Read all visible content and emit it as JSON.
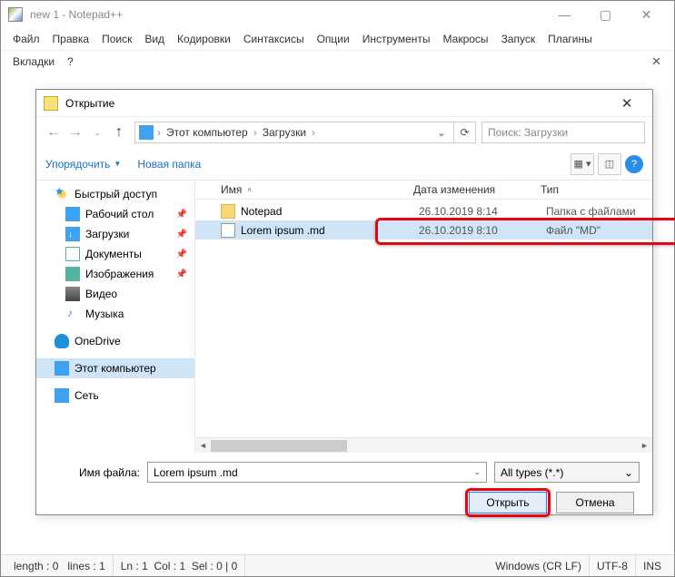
{
  "app": {
    "title": "new 1 - Notepad++"
  },
  "menus": {
    "file": "Файл",
    "edit": "Правка",
    "search": "Поиск",
    "view": "Вид",
    "encoding": "Кодировки",
    "syntax": "Синтаксисы",
    "options": "Опции",
    "tools": "Инструменты",
    "macros": "Макросы",
    "run": "Запуск",
    "plugins": "Плагины",
    "tabs": "Вкладки",
    "help": "?"
  },
  "dialog": {
    "title": "Открытие",
    "breadcrumb": {
      "root": "Этот компьютер",
      "folder": "Загрузки"
    },
    "search_placeholder": "Поиск: Загрузки",
    "organize": "Упорядочить",
    "new_folder": "Новая папка",
    "columns": {
      "name": "Имя",
      "date": "Дата изменения",
      "type": "Тип"
    },
    "sidebar": {
      "quick": "Быстрый доступ",
      "desktop": "Рабочий стол",
      "downloads": "Загрузки",
      "documents": "Документы",
      "pictures": "Изображения",
      "videos": "Видео",
      "music": "Музыка",
      "onedrive": "OneDrive",
      "this_pc": "Этот компьютер",
      "network": "Сеть"
    },
    "files": [
      {
        "name": "Notepad",
        "date": "26.10.2019 8:14",
        "type": "Папка с файлами",
        "selected": false,
        "icon": "folder"
      },
      {
        "name": "Lorem ipsum .md",
        "date": "26.10.2019 8:10",
        "type": "Файл \"MD\"",
        "selected": true,
        "icon": "file"
      }
    ],
    "file_name_label": "Имя файла:",
    "file_name_value": "Lorem ipsum .md",
    "file_type": "All types (*.*)",
    "open_btn": "Открыть",
    "cancel_btn": "Отмена"
  },
  "status": {
    "length": "length : 0",
    "lines": "lines : 1",
    "ln": "Ln : 1",
    "col": "Col : 1",
    "sel": "Sel : 0 | 0",
    "eol": "Windows (CR LF)",
    "enc": "UTF-8",
    "ins": "INS"
  }
}
